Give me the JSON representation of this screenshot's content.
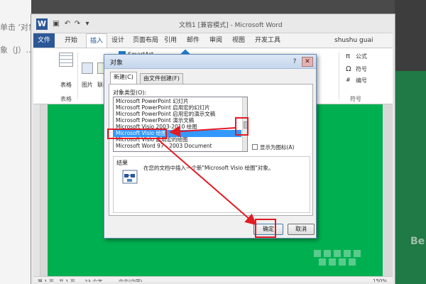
{
  "background": {
    "left_snippets": [
      "单击 ‘对象’",
      "象（J）…"
    ],
    "right_snippet": "Be"
  },
  "window": {
    "title": "文档1 [兼容模式] - Microsoft Word",
    "user": "shushu guai",
    "tabs": [
      "文件",
      "开始",
      "插入",
      "设计",
      "页面布局",
      "引用",
      "邮件",
      "审阅",
      "视图",
      "开发工具"
    ],
    "active_tab": "插入"
  },
  "ribbon": {
    "table_label": "表格",
    "table_group": "表格",
    "picture_label": "图片",
    "online_picture_label": "联机",
    "smartart_label": "SmartArt",
    "formula_label": "公式",
    "symbol_label": "符号",
    "number_label": "编号",
    "symbol_group": "符号",
    "pi_symbol": "π"
  },
  "status_bar": {
    "page": "第 1 页，共 1 页",
    "words": "23 个字",
    "language": "中文(中国)",
    "zoom": "150%"
  },
  "dialog": {
    "title": "对象",
    "help": "?",
    "close": "✕",
    "tabs": [
      "新建(C)",
      "由文件创建(F)"
    ],
    "object_type_label": "对象类型(O):",
    "items": [
      "Microsoft PowerPoint 幻灯片",
      "Microsoft PowerPoint 启用宏的幻灯片",
      "Microsoft PowerPoint 启用宏的演示文稿",
      "Microsoft PowerPoint 演示文稿",
      "Microsoft Visio 2003-2010 绘图",
      "Microsoft Visio 绘图",
      "Microsoft Visio 启用宏的绘图",
      "Microsoft Word 97 - 2003 Document"
    ],
    "selected_index": 5,
    "show_as_icon_label": "显示为图标(A)",
    "result_label": "结果",
    "result_text": "在您的文档中插入一个新\"Microsoft Visio 绘图\"对象。",
    "ok_label": "确定",
    "cancel_label": "取消"
  },
  "colors": {
    "word_blue": "#2b5797",
    "page_green": "#00b050",
    "selection_blue": "#3399ff",
    "annotation_red": "#e31b23"
  }
}
